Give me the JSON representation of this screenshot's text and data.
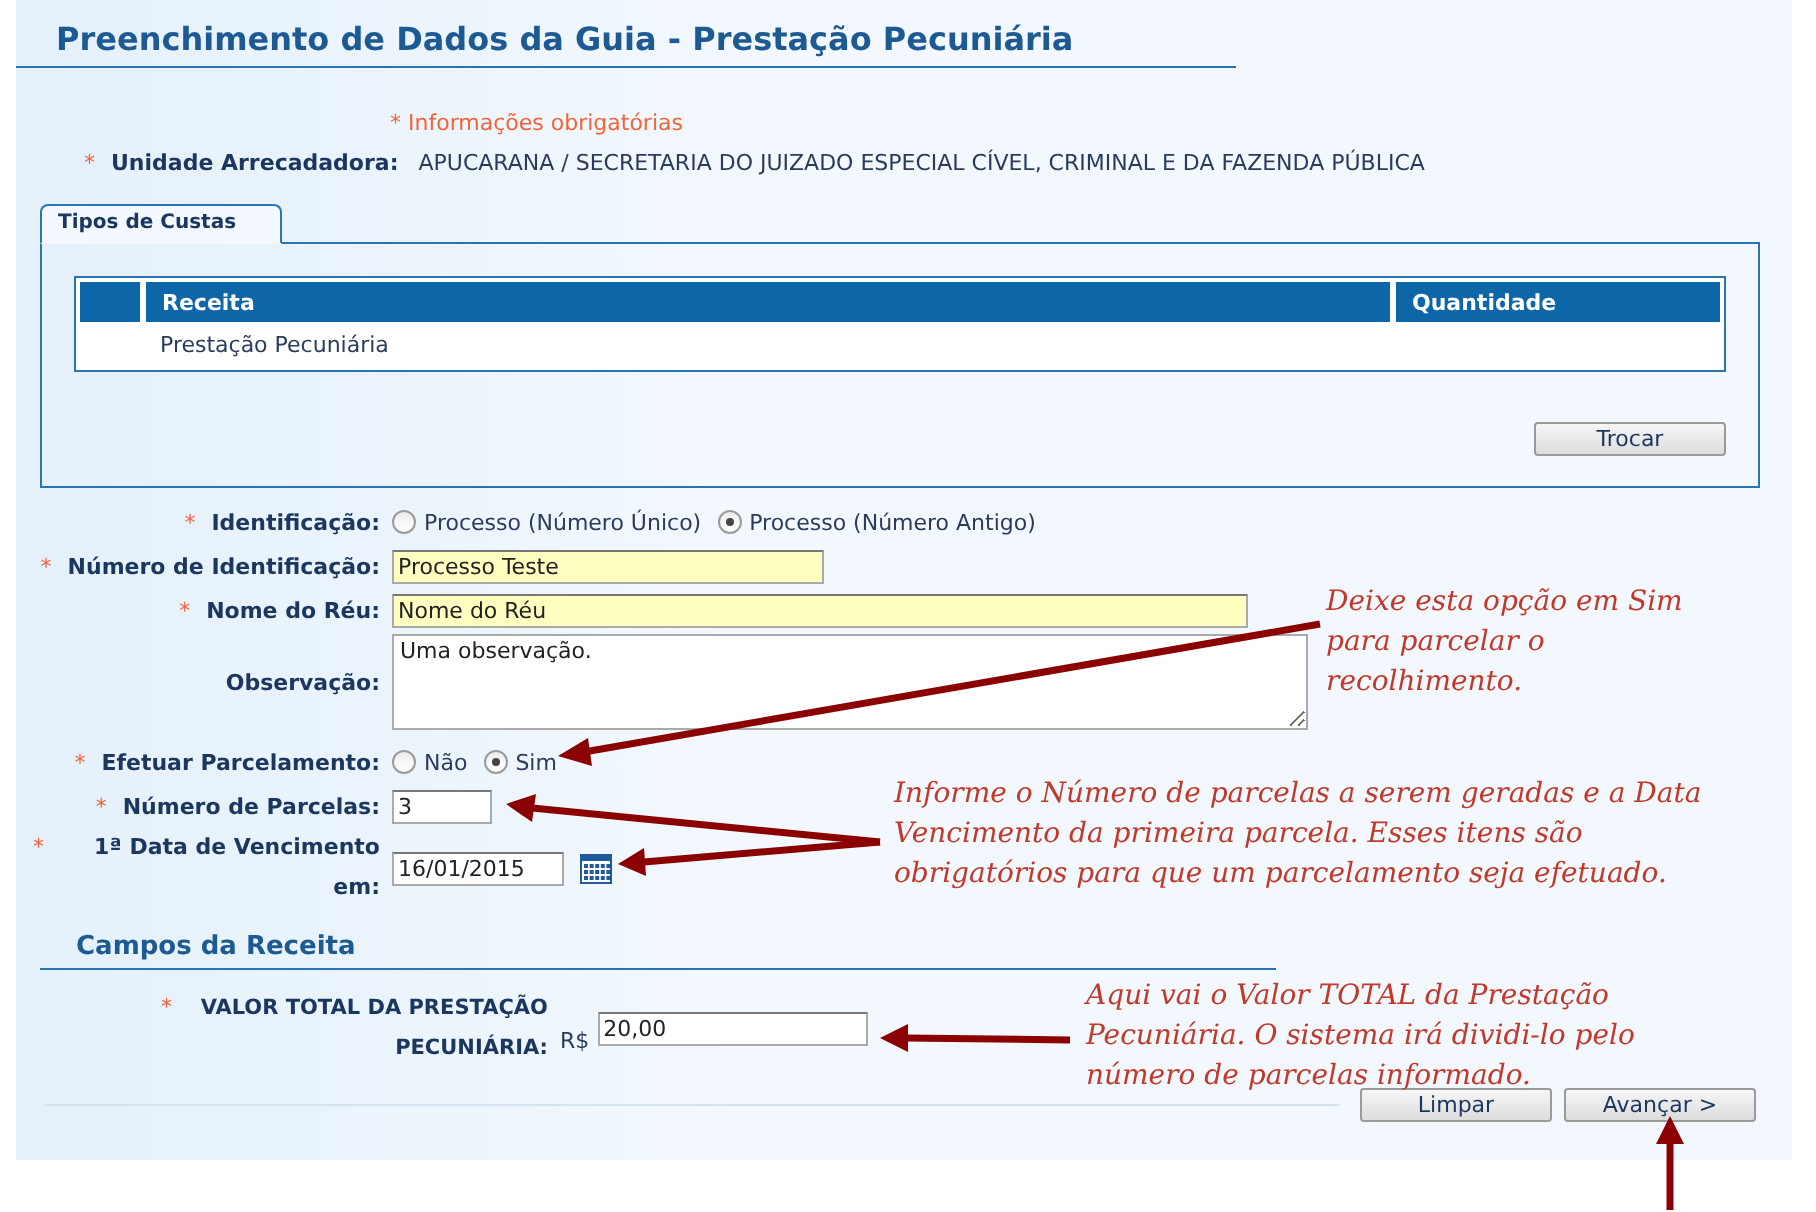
{
  "page_title": "Preenchimento de Dados da Guia - Prestação Pecuniária",
  "required_note": "* Informações obrigatórias",
  "unidade": {
    "required_mark": "*",
    "label": "Unidade Arrecadadora:",
    "value": "APUCARANA / SECRETARIA DO JUIZADO ESPECIAL CÍVEL, CRIMINAL E DA FAZENDA PÚBLICA"
  },
  "tabs": [
    {
      "label": "Tipos de Custas",
      "selected": true
    }
  ],
  "table": {
    "columns": [
      "Receita",
      "Quantidade"
    ],
    "rows": [
      {
        "receita": "Prestação Pecuniária"
      }
    ]
  },
  "trocar_button": "Trocar",
  "fields": [
    {
      "kind": "radio",
      "required_mark": "*",
      "label": "Identificação:",
      "options": [
        {
          "label": "Processo (Número Único)",
          "selected": false
        },
        {
          "label": "Processo (Número Antigo)",
          "selected": true
        }
      ]
    },
    {
      "kind": "text",
      "required_mark": "*",
      "label": "Número de Identificação:",
      "value": "Processo Teste",
      "highlighted": true
    },
    {
      "kind": "longtext",
      "required_mark": "*",
      "label": "Nome do Réu:",
      "value": "Nome do Réu",
      "highlighted": true
    },
    {
      "kind": "textarea",
      "label": "Observação:",
      "value": "Uma observação."
    },
    {
      "kind": "radio",
      "required_mark": "*",
      "label": "Efetuar Parcelamento:",
      "options": [
        {
          "label": "Não",
          "selected": false
        },
        {
          "label": "Sim",
          "selected": true
        }
      ]
    },
    {
      "kind": "number",
      "required_mark": "*",
      "label": "Número de Parcelas:",
      "value": "3",
      "highlighted": false
    },
    {
      "kind": "date",
      "required_mark": "*",
      "label": "1ª Data de Vencimento em:",
      "value": "16/01/2015"
    }
  ],
  "section_title": "Campos da Receita",
  "valor": {
    "required_mark": "*",
    "label": "VALOR TOTAL DA PRESTAÇÃO PECUNIÁRIA:",
    "prefix": "R$",
    "value": "20,00"
  },
  "buttons": [
    "Limpar",
    "Avançar >"
  ],
  "annotations": [
    "Deixe esta opção em Sim para parcelar o recolhimento.",
    "Informe o Número de parcelas a serem geradas e a Data Vencimento da primeira parcela. Esses itens são obrigatórios para que um parcelamento seja efetuado.",
    "Aqui vai o Valor TOTAL da Prestação Pecuniária. O sistema irá dividi-lo pelo número de parcelas informado."
  ]
}
